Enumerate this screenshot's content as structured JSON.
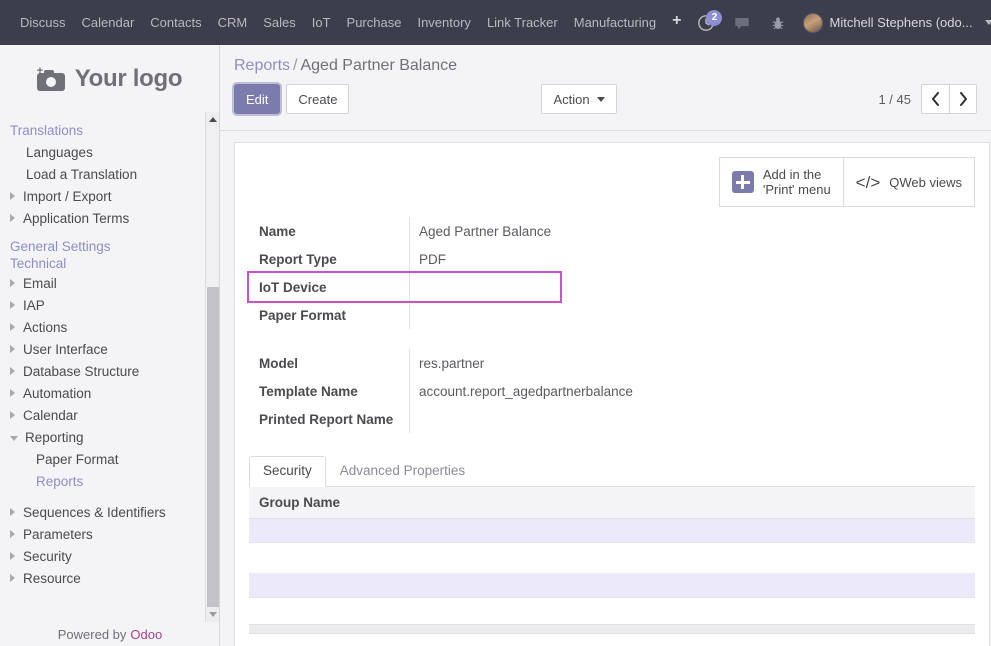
{
  "navbar": {
    "menus": [
      {
        "label": "Discuss"
      },
      {
        "label": "Calendar"
      },
      {
        "label": "Contacts"
      },
      {
        "label": "CRM"
      },
      {
        "label": "Sales"
      },
      {
        "label": "IoT"
      },
      {
        "label": "Purchase"
      },
      {
        "label": "Inventory"
      },
      {
        "label": "Link Tracker"
      },
      {
        "label": "Manufacturing"
      }
    ],
    "plus_label": "+",
    "activity_badge": "2",
    "icons": {
      "activity": "clock-icon",
      "messaging": "chat-bubble-icon",
      "debug": "bug-icon"
    },
    "user": {
      "name": "Mitchell Stephens (odo...",
      "avatar": "user-avatar"
    }
  },
  "sidebar": {
    "logo_text": "Your logo",
    "sections": [
      {
        "title": "Translations",
        "items": [
          {
            "label": "Languages",
            "arrow": "none",
            "active": false
          },
          {
            "label": "Load a Translation",
            "arrow": "none",
            "active": false
          },
          {
            "label": "Import / Export",
            "arrow": "right",
            "active": false
          },
          {
            "label": "Application Terms",
            "arrow": "right",
            "active": false
          }
        ]
      }
    ],
    "general_settings": "General Settings",
    "technical": "Technical",
    "technical_items": [
      {
        "label": "Email",
        "arrow": "right",
        "active": false,
        "child": false
      },
      {
        "label": "IAP",
        "arrow": "right",
        "active": false,
        "child": false
      },
      {
        "label": "Actions",
        "arrow": "right",
        "active": false,
        "child": false
      },
      {
        "label": "User Interface",
        "arrow": "right",
        "active": false,
        "child": false
      },
      {
        "label": "Database Structure",
        "arrow": "right",
        "active": false,
        "child": false
      },
      {
        "label": "Automation",
        "arrow": "right",
        "active": false,
        "child": false
      },
      {
        "label": "Calendar",
        "arrow": "right",
        "active": false,
        "child": false
      },
      {
        "label": "Reporting",
        "arrow": "down",
        "active": false,
        "child": false
      },
      {
        "label": "Paper Format",
        "arrow": "none",
        "active": false,
        "child": true
      },
      {
        "label": "Reports",
        "arrow": "none",
        "active": true,
        "child": true
      }
    ],
    "bottom_items": [
      {
        "label": "Sequences & Identifiers",
        "arrow": "right",
        "active": false
      },
      {
        "label": "Parameters",
        "arrow": "right",
        "active": false
      },
      {
        "label": "Security",
        "arrow": "right",
        "active": false
      },
      {
        "label": "Resource",
        "arrow": "right",
        "active": false
      }
    ],
    "powered_by": "Powered by",
    "powered_brand": "Odoo"
  },
  "control_panel": {
    "breadcrumb_root": "Reports",
    "breadcrumb_sep": "/",
    "breadcrumb_current": "Aged Partner Balance",
    "edit_label": "Edit",
    "create_label": "Create",
    "action_label": "Action",
    "pager_text": "1 / 45",
    "prev_icon": "chevron-left-icon",
    "next_icon": "chevron-right-icon"
  },
  "stat_buttons": [
    {
      "label_line1": "Add in the",
      "label_line2": "'Print' menu",
      "icon": "plus-square-icon"
    },
    {
      "label": "QWeb views",
      "icon": "code-icon",
      "glyph": "</>"
    }
  ],
  "form": {
    "group_1": [
      {
        "label": "Name",
        "value": "Aged Partner Balance",
        "highlighted": false
      },
      {
        "label": "Report Type",
        "value": "PDF",
        "highlighted": false
      },
      {
        "label": "IoT Device",
        "value": "",
        "highlighted": true
      },
      {
        "label": "Paper Format",
        "value": "",
        "highlighted": false
      }
    ],
    "group_2": [
      {
        "label": "Model",
        "value": "res.partner",
        "highlighted": false
      },
      {
        "label": "Template Name",
        "value": "account.report_agedpartnerbalance",
        "highlighted": false
      },
      {
        "label": "Printed Report Name",
        "value": "",
        "highlighted": false
      }
    ]
  },
  "notebook": {
    "tabs": [
      {
        "label": "Security",
        "active": true
      },
      {
        "label": "Advanced Properties",
        "active": false
      }
    ],
    "security_table": {
      "columns": [
        "Group Name"
      ],
      "rows": [
        {
          "group_name": ""
        }
      ]
    }
  },
  "colors": {
    "navbar_bg": "#3c3e4b",
    "sidebar_bg": "#f4f4f6",
    "accent_purple": "#7c7bad",
    "link_purple": "#8e8ec4",
    "highlight_border": "#cc4fcc",
    "row_lavender": "#eceafa",
    "odoo_brand": "#a24689"
  }
}
